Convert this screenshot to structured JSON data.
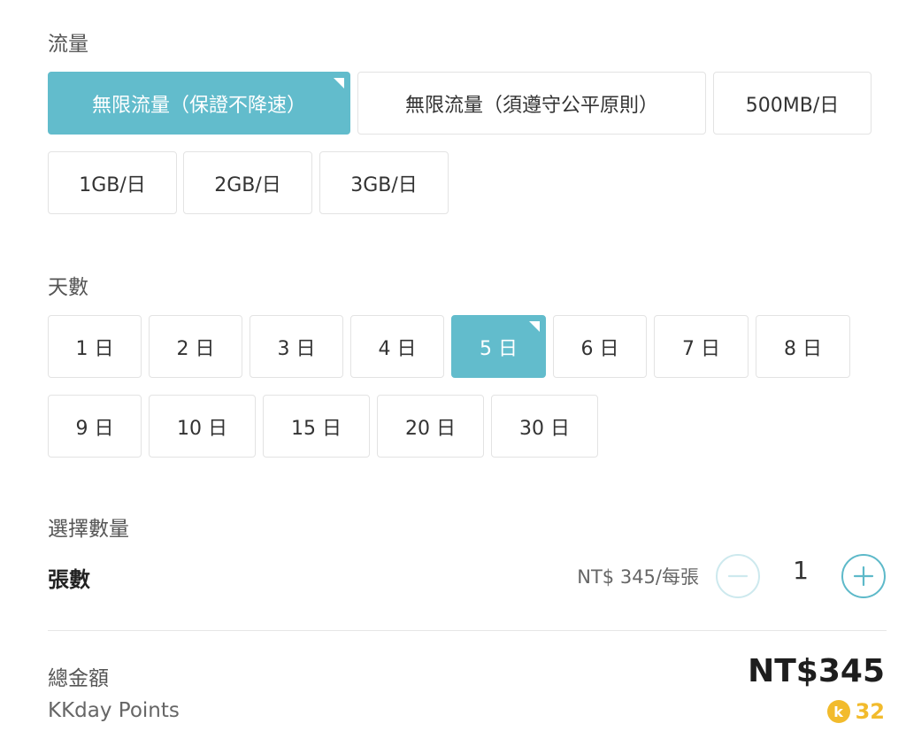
{
  "data_section": {
    "label": "流量",
    "options": [
      {
        "label": "無限流量（保證不降速）",
        "selected": true
      },
      {
        "label": "無限流量（須遵守公平原則）",
        "selected": false
      },
      {
        "label": "500MB/日",
        "selected": false
      },
      {
        "label": "1GB/日",
        "selected": false
      },
      {
        "label": "2GB/日",
        "selected": false
      },
      {
        "label": "3GB/日",
        "selected": false
      }
    ]
  },
  "days_section": {
    "label": "天數",
    "options": [
      {
        "label": "1 日",
        "selected": false
      },
      {
        "label": "2 日",
        "selected": false
      },
      {
        "label": "3 日",
        "selected": false
      },
      {
        "label": "4 日",
        "selected": false
      },
      {
        "label": "5 日",
        "selected": true
      },
      {
        "label": "6 日",
        "selected": false
      },
      {
        "label": "7 日",
        "selected": false
      },
      {
        "label": "8 日",
        "selected": false
      },
      {
        "label": "9 日",
        "selected": false
      },
      {
        "label": "10 日",
        "selected": false
      },
      {
        "label": "15 日",
        "selected": false
      },
      {
        "label": "20 日",
        "selected": false
      },
      {
        "label": "30 日",
        "selected": false
      }
    ]
  },
  "quantity_section": {
    "label": "選擇數量",
    "item_label": "張數",
    "unit_price": "NT$ 345/每張",
    "quantity": "1",
    "minus_icon": "minus-circle-icon",
    "plus_icon": "plus-circle-icon",
    "minus_disabled": true
  },
  "summary": {
    "total_label": "總金額",
    "total_value": "NT$345",
    "points_label": "KKday Points",
    "points_value": "32",
    "points_icon": "kkday-coin-icon",
    "coin_glyph": "k"
  },
  "colors": {
    "accent": "#62bccc",
    "border": "#e3e3e3",
    "points": "#f2bb2c"
  }
}
